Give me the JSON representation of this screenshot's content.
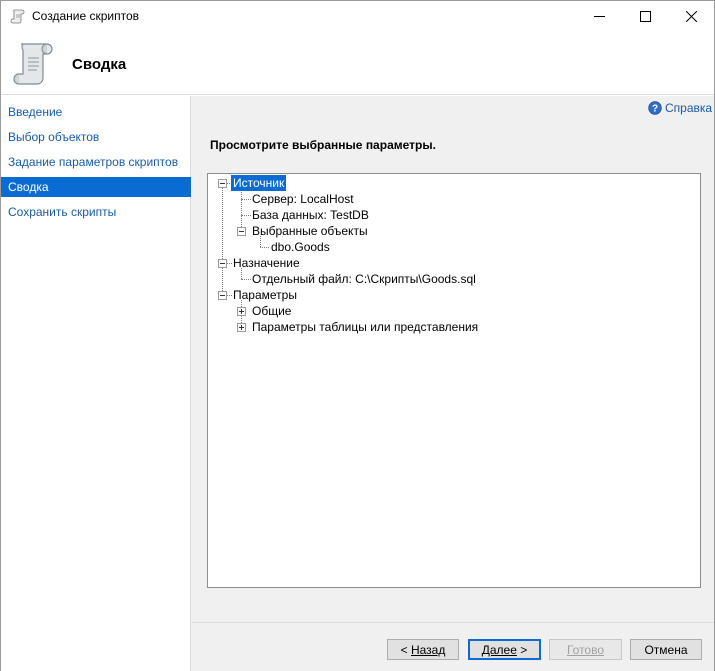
{
  "window": {
    "title": "Создание скриптов",
    "controls": {
      "minimize": "minimize-icon",
      "maximize": "maximize-icon",
      "close": "close-icon"
    }
  },
  "header": {
    "title": "Сводка",
    "icon": "scroll-icon"
  },
  "nav": {
    "items": [
      {
        "label": "Введение",
        "active": false
      },
      {
        "label": "Выбор объектов",
        "active": false
      },
      {
        "label": "Задание параметров скриптов",
        "active": false
      },
      {
        "label": "Сводка",
        "active": true
      },
      {
        "label": "Сохранить скрипты",
        "active": false
      }
    ]
  },
  "help": {
    "label": "Справка",
    "icon": "help-icon"
  },
  "main": {
    "instruction": "Просмотрите выбранные параметры.",
    "tree": {
      "source": "Источник",
      "server": "Сервер: LocalHost",
      "database": "База данных: TestDB",
      "selected_objects": "Выбранные объекты",
      "object": "dbo.Goods",
      "destination": "Назначение",
      "file": "Отдельный файл: C:\\Скрипты\\Goods.sql",
      "parameters": "Параметры",
      "general": "Общие",
      "table_view_params": "Параметры таблицы или представления"
    }
  },
  "buttons": {
    "back_prefix": "< ",
    "back_label": "Назад",
    "next_label": "Далее",
    "next_suffix": " >",
    "finish_label": "Готово",
    "cancel_label": "Отмена"
  },
  "colors": {
    "accent": "#0a6cd2",
    "link": "#1a5aa5",
    "panel": "#f0f0f0"
  }
}
